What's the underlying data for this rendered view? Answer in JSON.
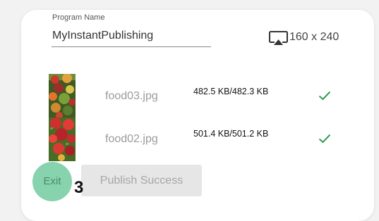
{
  "program": {
    "label": "Program Name",
    "value": "MyInstantPublishing"
  },
  "resolution": {
    "icon": "airplay-screen-icon",
    "text": "160 x 240"
  },
  "files": [
    {
      "name": "food03.jpg",
      "size": "482.5 KB/482.3 KB",
      "status_icon": "checkmark-icon",
      "status_color": "#2e9e52"
    },
    {
      "name": "food02.jpg",
      "size": "501.4 KB/501.2 KB",
      "status_icon": "checkmark-icon",
      "status_color": "#2e9e52"
    }
  ],
  "actions": {
    "exit_label": "Exit",
    "publish_label": "Publish Success"
  },
  "step_badge": "3",
  "colors": {
    "exit_bg": "#86d3ad",
    "check": "#2e9e52",
    "publish_bg": "#e6e6e6"
  }
}
